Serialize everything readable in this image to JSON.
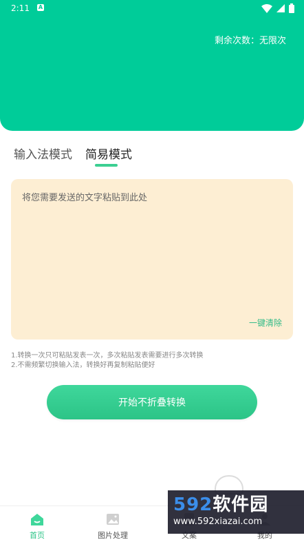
{
  "status_bar": {
    "time": "2:11",
    "a_badge": "A"
  },
  "header": {
    "remaining_label": "剩余次数：无限次"
  },
  "tabs": [
    {
      "label": "输入法模式"
    },
    {
      "label": "简易模式"
    }
  ],
  "input": {
    "placeholder": "将您需要发送的文字粘贴到此处",
    "clear_label": "一键清除"
  },
  "notes": [
    "1.转换一次只可粘贴发表一次，多次粘贴发表需要进行多次转换",
    "2.不需频繁切换输入法，转换好再复制粘贴便好"
  ],
  "main_button": {
    "label": "开始不折叠转换"
  },
  "bottom_nav": [
    {
      "label": "首页",
      "icon": "home-icon"
    },
    {
      "label": "图片处理",
      "icon": "image-icon"
    },
    {
      "label": "文案",
      "icon": "copy-icon"
    },
    {
      "label": "我的",
      "icon": "user-icon"
    }
  ],
  "watermark": {
    "brand_number": "592",
    "brand_text": "软件园",
    "url": "www.592xiazai.com"
  },
  "colors": {
    "primary": "#00cc99",
    "button": "#33cc90",
    "input_bg": "#fdeed3"
  }
}
